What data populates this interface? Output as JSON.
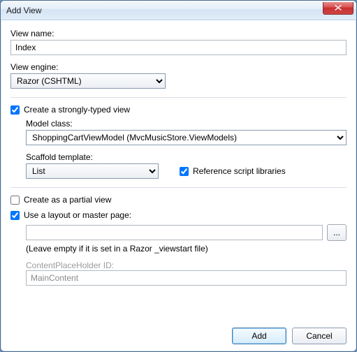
{
  "window": {
    "title": "Add View"
  },
  "viewName": {
    "label": "View name:",
    "value": "Index"
  },
  "viewEngine": {
    "label": "View engine:",
    "value": "Razor (CSHTML)"
  },
  "stronglyTyped": {
    "checked": true,
    "label": "Create a strongly-typed view",
    "modelClass": {
      "label": "Model class:",
      "value": "ShoppingCartViewModel (MvcMusicStore.ViewModels)"
    },
    "scaffold": {
      "label": "Scaffold template:",
      "value": "List"
    },
    "refScripts": {
      "checked": true,
      "label": "Reference script libraries"
    }
  },
  "partial": {
    "checked": false,
    "label": "Create as a partial view"
  },
  "layout": {
    "checked": true,
    "label": "Use a layout or master page:",
    "path": "",
    "browse": "...",
    "hint": "(Leave empty if it is set in a Razor _viewstart file)",
    "cphLabel": "ContentPlaceHolder ID:",
    "cphValue": "MainContent"
  },
  "buttons": {
    "add": "Add",
    "cancel": "Cancel"
  }
}
